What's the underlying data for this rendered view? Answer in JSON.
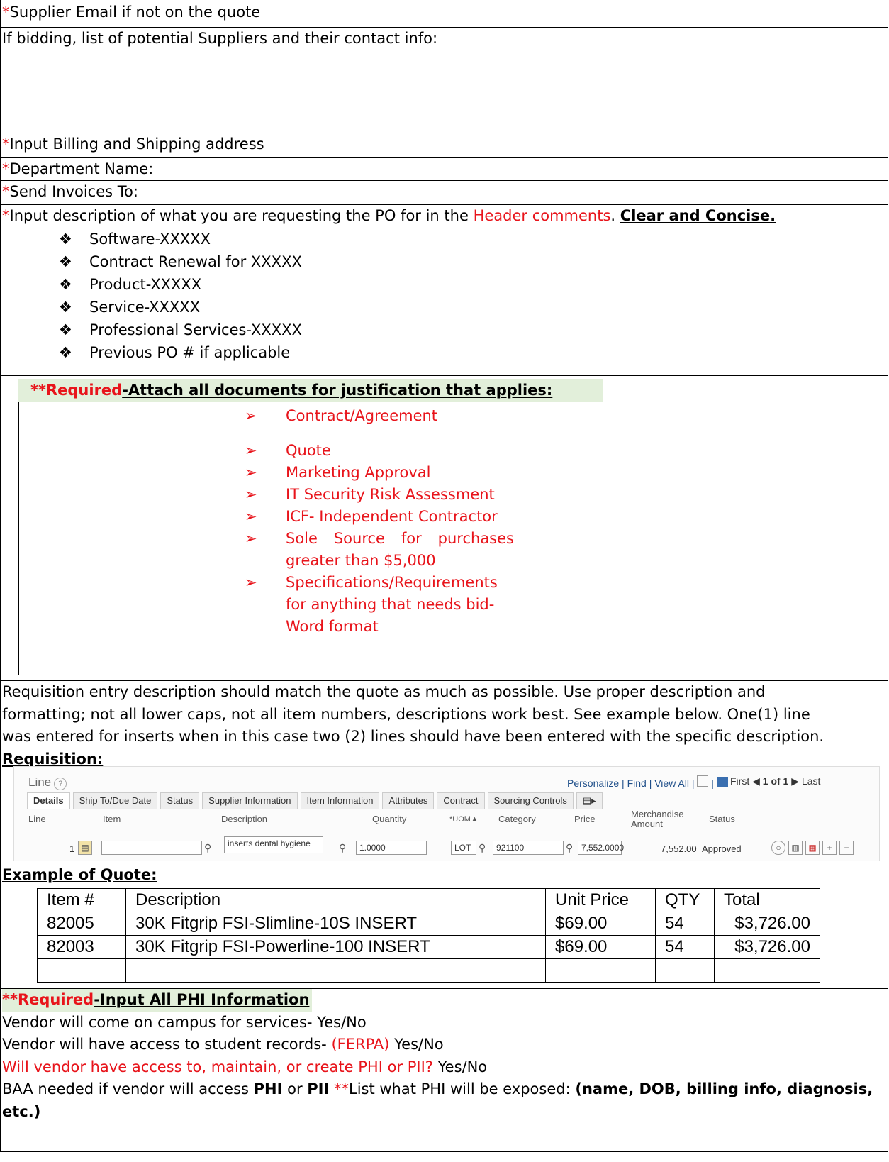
{
  "rows": {
    "supplier_email": {
      "star": "*",
      "text": "Supplier Email if not on the quote"
    },
    "bidding": "If bidding, list of potential Suppliers and their contact info:",
    "billing": {
      "star": "*",
      "text": "Input Billing and Shipping address"
    },
    "department": {
      "star": "*",
      "text": "Department Name:"
    },
    "invoices": {
      "star": "*",
      "text": "Send Invoices To:"
    }
  },
  "description": {
    "star": "*",
    "text1": "Input description of what you are requesting the PO for in the ",
    "header_comments": "Header comments",
    "text2": ". ",
    "emphasis": "Clear and Concise.",
    "bullet_marker": "❖",
    "bullets": [
      "Software-XXXXX",
      "Contract Renewal for XXXXX",
      "Product-XXXXX",
      "Service-XXXXX",
      "Professional Services-XXXXX",
      "Previous PO # if applicable"
    ]
  },
  "attach": {
    "stars": "**",
    "required": "Required",
    "text": "-Attach all documents for justification that applies:",
    "arrow": "➢",
    "items": [
      "Contract/Agreement",
      "Quote",
      "Marketing Approval",
      "IT Security Risk Assessment",
      "ICF- Independent Contractor"
    ],
    "sole_source": [
      "Sole Source for purchases",
      "greater than $5,000"
    ],
    "specs": [
      "Specifications/Requirements",
      "for anything that needs bid-",
      "Word format"
    ]
  },
  "requisition": {
    "paragraph_lines": [
      "Requisition entry description should match the quote as much as possible. Use proper description and",
      "formatting; not all lower caps, not all item numbers, descriptions work best. See example below. One(1) line",
      "was entered for inserts when in this case two (2) lines should have been entered with the specific description."
    ],
    "label": "Requisition:",
    "panel": {
      "title": "Line",
      "help": "?",
      "tools": "Personalize | Find | View All |",
      "nav": {
        "first": "First",
        "count": "1 of 1",
        "last": "Last"
      },
      "tabs": [
        "Details",
        "Ship To/Due Date",
        "Status",
        "Supplier Information",
        "Item Information",
        "Attributes",
        "Contract",
        "Sourcing Controls"
      ],
      "headers": {
        "line": "Line",
        "item": "Item",
        "description": "Description",
        "quantity": "Quantity",
        "uom": "*UOM▲",
        "category": "Category",
        "price": "Price",
        "merch1": "Merchandise",
        "merch2": "Amount",
        "status": "Status"
      },
      "row": {
        "line": "1",
        "item": "",
        "description": "inserts dental hygiene",
        "quantity": "1.0000",
        "uom": "LOT",
        "category": "921100",
        "price": "7,552.0000",
        "amount": "7,552.00",
        "status": "Approved"
      }
    },
    "quote_label": "Example of Quote:",
    "quote": {
      "headers": [
        "Item #",
        "Description",
        "Unit Price",
        "QTY",
        "Total"
      ],
      "rows": [
        [
          "82005",
          "30K Fitgrip FSI-Slimline-10S INSERT",
          "$69.00",
          "54",
          "$3,726.00"
        ],
        [
          "82003",
          "30K Fitgrip FSI-Powerline-100 INSERT",
          "$69.00",
          "54",
          "$3,726.00"
        ]
      ]
    }
  },
  "phi": {
    "stars": "**",
    "required": "Required",
    "text": "-Input All PHI Information",
    "line1": "Vendor will come on campus for services- Yes/No",
    "line2a": "Vendor will have access to student records- ",
    "ferpa": "(FERPA)",
    "line2b": " Yes/No",
    "line3a": "Will vendor have access to, maintain, or create PHI or PII?",
    "line3b": " Yes/No",
    "line4a": "BAA needed if vendor will access ",
    "phi_word": "PHI",
    "or": " or ",
    "pii_word": "PII",
    "line4b": " ",
    "stars2": "**",
    "line4c": "List what PHI will be exposed: ",
    "line4d": "(name, DOB, billing info, diagnosis,",
    "line5": "etc.)"
  }
}
